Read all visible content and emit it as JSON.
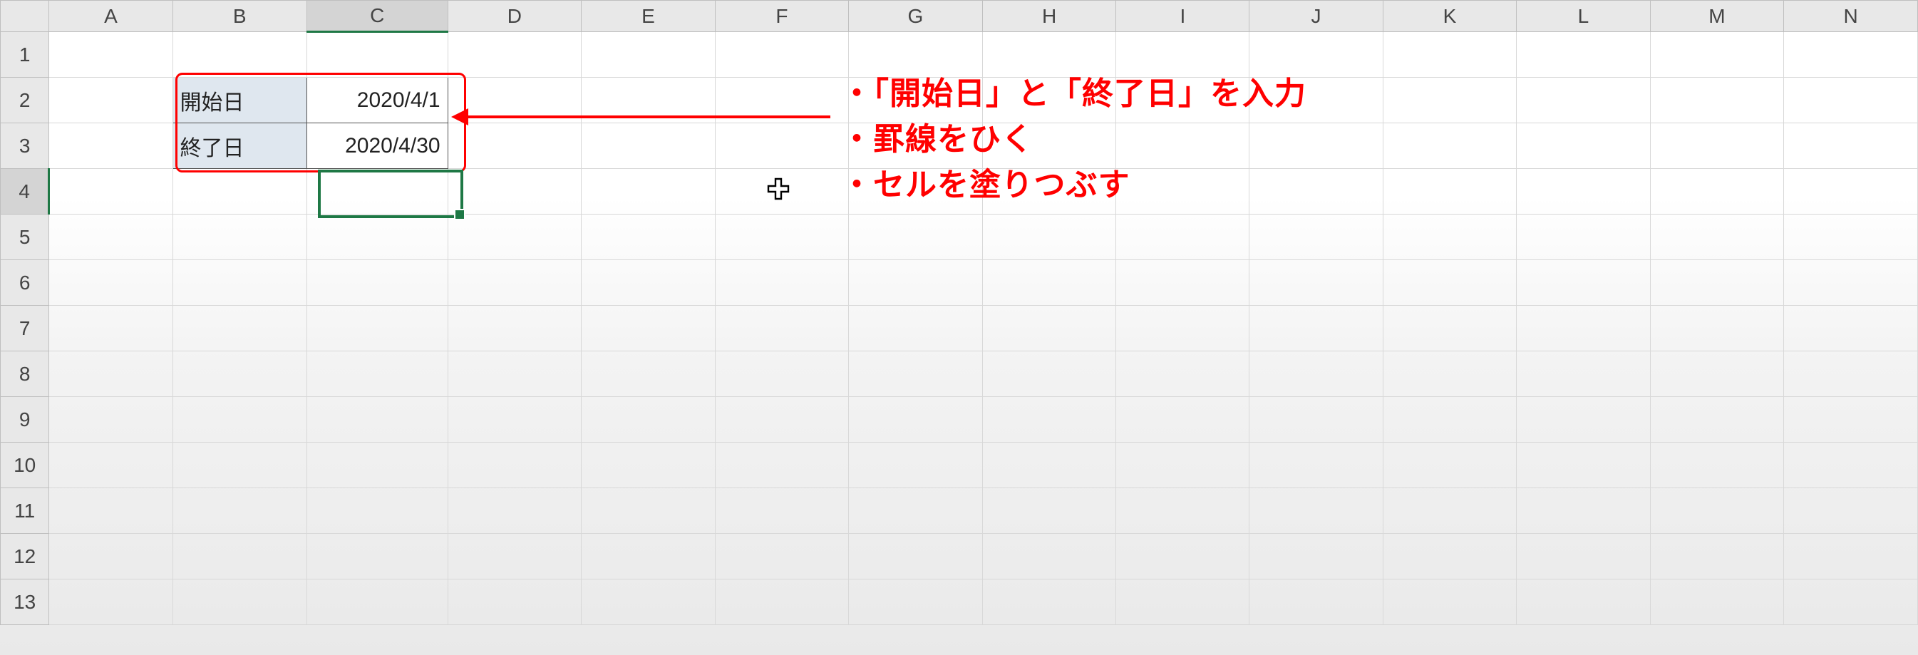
{
  "columns": [
    "A",
    "B",
    "C",
    "D",
    "E",
    "F",
    "G",
    "H",
    "I",
    "J",
    "K",
    "L",
    "M",
    "N"
  ],
  "rows": [
    "1",
    "2",
    "3",
    "4",
    "5",
    "6",
    "7",
    "8",
    "9",
    "10",
    "11",
    "12",
    "13"
  ],
  "cells": {
    "B2": "開始日",
    "C2": "2020/4/1",
    "B3": "終了日",
    "C3": "2020/4/30"
  },
  "active_cell": "C4",
  "annotation": {
    "line1": "・「開始日」と「終了日」を入力",
    "line2": "・罫線をひく",
    "line3": "・セルを塗りつぶす"
  },
  "colors": {
    "highlight_border": "#ff0000",
    "active_border": "#1e7845",
    "label_fill": "#dfe7ef"
  }
}
